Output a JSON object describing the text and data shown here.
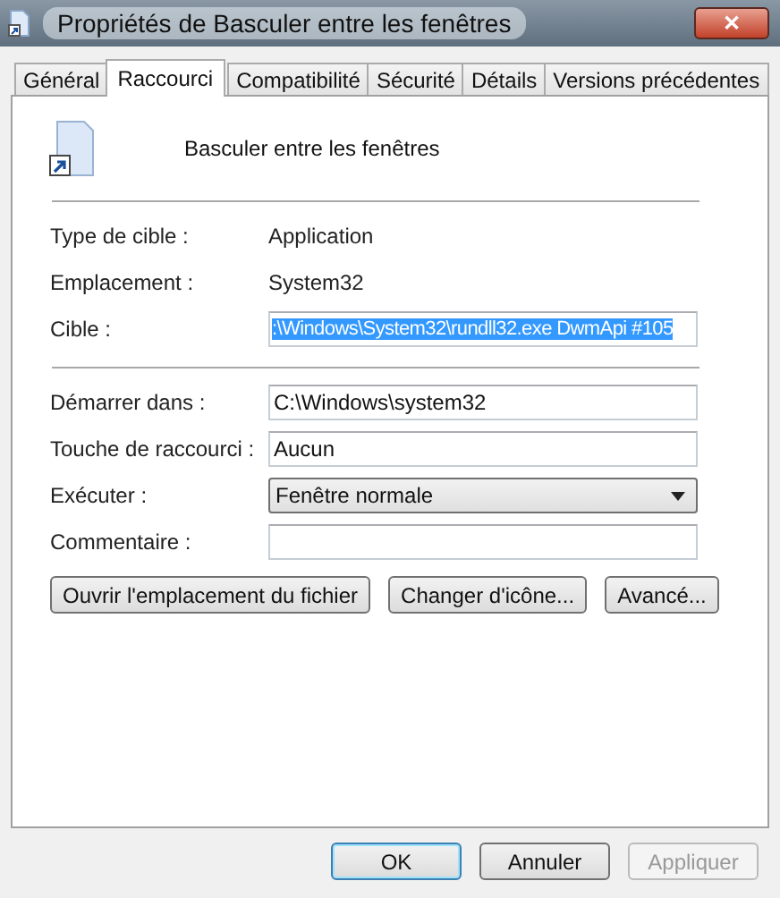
{
  "window": {
    "title": "Propriétés de Basculer entre les fenêtres",
    "close": "✕"
  },
  "tabs": [
    {
      "label": "Général",
      "selected": false
    },
    {
      "label": "Raccourci",
      "selected": true
    },
    {
      "label": "Compatibilité",
      "selected": false
    },
    {
      "label": "Sécurité",
      "selected": false
    },
    {
      "label": "Détails",
      "selected": false
    },
    {
      "label": "Versions précédentes",
      "selected": false
    }
  ],
  "shortcut_name": "Basculer entre les fenêtres",
  "details": [
    {
      "kind": "text",
      "label": "Type de cible :",
      "value": "Application"
    },
    {
      "kind": "text",
      "label": "Emplacement :",
      "value": "System32"
    },
    {
      "kind": "field",
      "label": "Cible :",
      "value": ":\\Windows\\System32\\rundll32.exe DwmApi #105",
      "highlighted": true
    }
  ],
  "settings": [
    {
      "kind": "field",
      "label": "Démarrer dans :",
      "value": "C:\\Windows\\system32"
    },
    {
      "kind": "field",
      "label": "Touche de raccourci :",
      "value": "Aucun"
    },
    {
      "kind": "select",
      "label": "Exécuter :",
      "value": "Fenêtre normale"
    },
    {
      "kind": "field",
      "label": "Commentaire :"
    }
  ],
  "actions": [
    "Ouvrir l'emplacement du fichier",
    "Changer d'icône...",
    "Avancé..."
  ],
  "buttons": [
    {
      "label": "OK",
      "default": true,
      "disabled": false
    },
    {
      "label": "Annuler",
      "default": false,
      "disabled": false
    },
    {
      "label": "Appliquer",
      "default": false,
      "disabled": true
    }
  ]
}
